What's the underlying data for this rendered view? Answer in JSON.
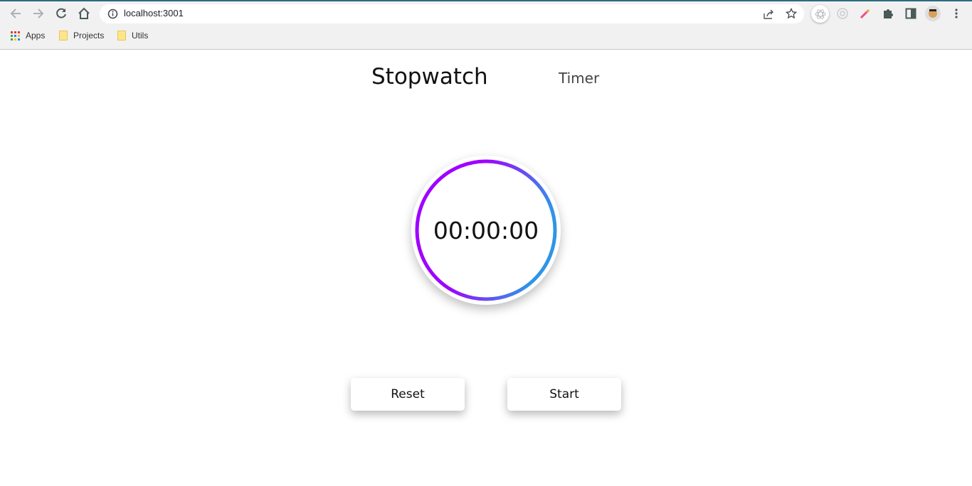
{
  "browser": {
    "url": "localhost:3001",
    "bookmarks": [
      {
        "label": "Apps",
        "icon": "apps-grid-icon"
      },
      {
        "label": "Projects",
        "icon": "folder-icon"
      },
      {
        "label": "Utils",
        "icon": "folder-icon"
      }
    ]
  },
  "nav": {
    "stopwatch": "Stopwatch",
    "timer": "Timer"
  },
  "stopwatch": {
    "time": "00:00:00",
    "ring_colors": [
      "#a000ff",
      "#2f95e6"
    ]
  },
  "buttons": {
    "reset": "Reset",
    "start": "Start"
  }
}
